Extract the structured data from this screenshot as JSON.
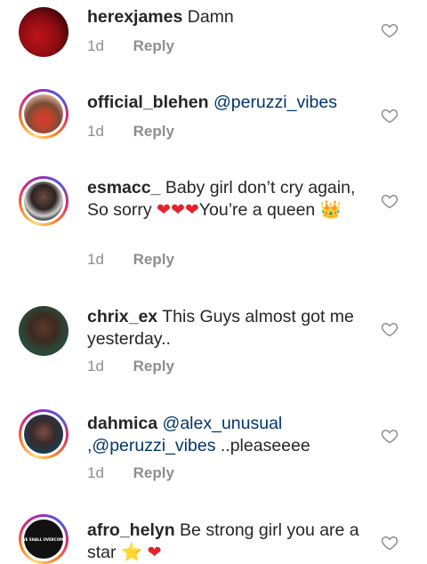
{
  "comments": [
    {
      "username": "herexjames",
      "text": "Damn",
      "time": "1d",
      "reply": "Reply"
    },
    {
      "username": "official_blehen",
      "mention": "@peruzzi_vibes",
      "time": "1d",
      "reply": "Reply"
    },
    {
      "username": "esmacc_",
      "text_a": "Baby girl don’t cry again, So sorry ",
      "hearts": "❤❤❤",
      "text_b": "You’re a queen ",
      "crown": "👑",
      "time": "1d",
      "reply": "Reply"
    },
    {
      "username": "chrix_ex",
      "text": "This Guys almost got me yesterday..",
      "time": "1d",
      "reply": "Reply"
    },
    {
      "username": "dahmica",
      "mention1": "@alex_unusual",
      "mention2": ",@peruzzi_vibes",
      "text": " ..pleaseeee",
      "time": "1d",
      "reply": "Reply"
    },
    {
      "username": "afro_helyn",
      "text": "Be strong girl  you are a star ",
      "star": "⭐",
      "heart": "❤"
    }
  ],
  "avatar_6_caption": "WE SHALL OVERCOME",
  "icons": {
    "like": "heart-outline-icon"
  },
  "colors": {
    "mention": "#00376b",
    "meta": "#8e8e8e",
    "heart": "#e3222a"
  }
}
